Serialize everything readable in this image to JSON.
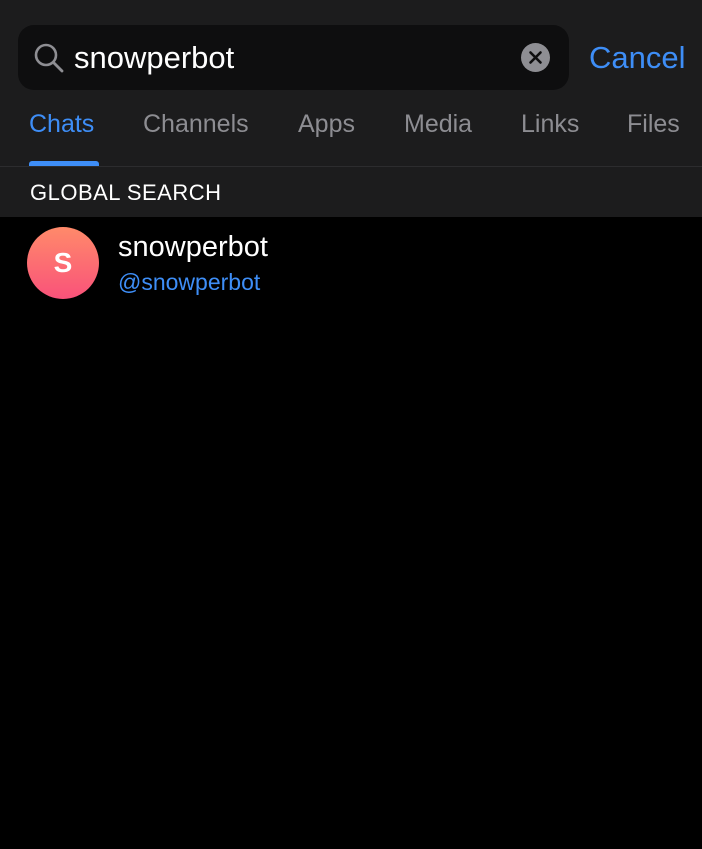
{
  "search": {
    "query": "snowperbot",
    "cancel_label": "Cancel",
    "search_icon": "magnifying-glass",
    "clear_icon": "close-circle"
  },
  "tabs": [
    {
      "label": "Chats",
      "active": true
    },
    {
      "label": "Channels",
      "active": false
    },
    {
      "label": "Apps",
      "active": false
    },
    {
      "label": "Media",
      "active": false
    },
    {
      "label": "Links",
      "active": false
    },
    {
      "label": "Files",
      "active": false
    }
  ],
  "section": {
    "title": "GLOBAL SEARCH"
  },
  "results": [
    {
      "avatar_letter": "S",
      "name": "snowperbot",
      "username": "@snowperbot"
    }
  ],
  "colors": {
    "accent": "#3e8ef7",
    "background": "#000000",
    "header_bg": "#1c1c1d",
    "inactive_tab": "#8d8d92"
  }
}
